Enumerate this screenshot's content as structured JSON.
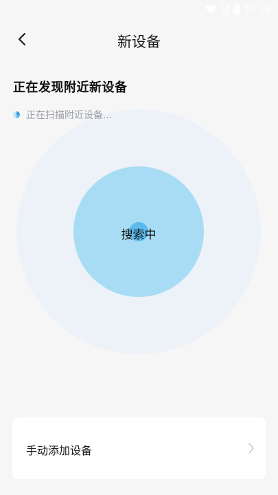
{
  "status_bar": {
    "time": "10:19",
    "icons": [
      "wifi-icon",
      "no-sim-icon",
      "battery-icon"
    ]
  },
  "header": {
    "title": "新设备",
    "back_icon": "back-arrow-icon"
  },
  "main": {
    "section_title": "正在发现附近新设备",
    "scan_status": "正在扫描附近设备...",
    "radar_label": "搜索中"
  },
  "manual_add": {
    "label": "手动添加设备",
    "icon": "chevron-right-icon"
  },
  "colors": {
    "background": "#f6f6f7",
    "radar_outer": "#edf2f8",
    "radar_inner": "#a7dcf4",
    "radar_dot": "#5bb9ec",
    "muted_text": "#9a9ea6"
  }
}
